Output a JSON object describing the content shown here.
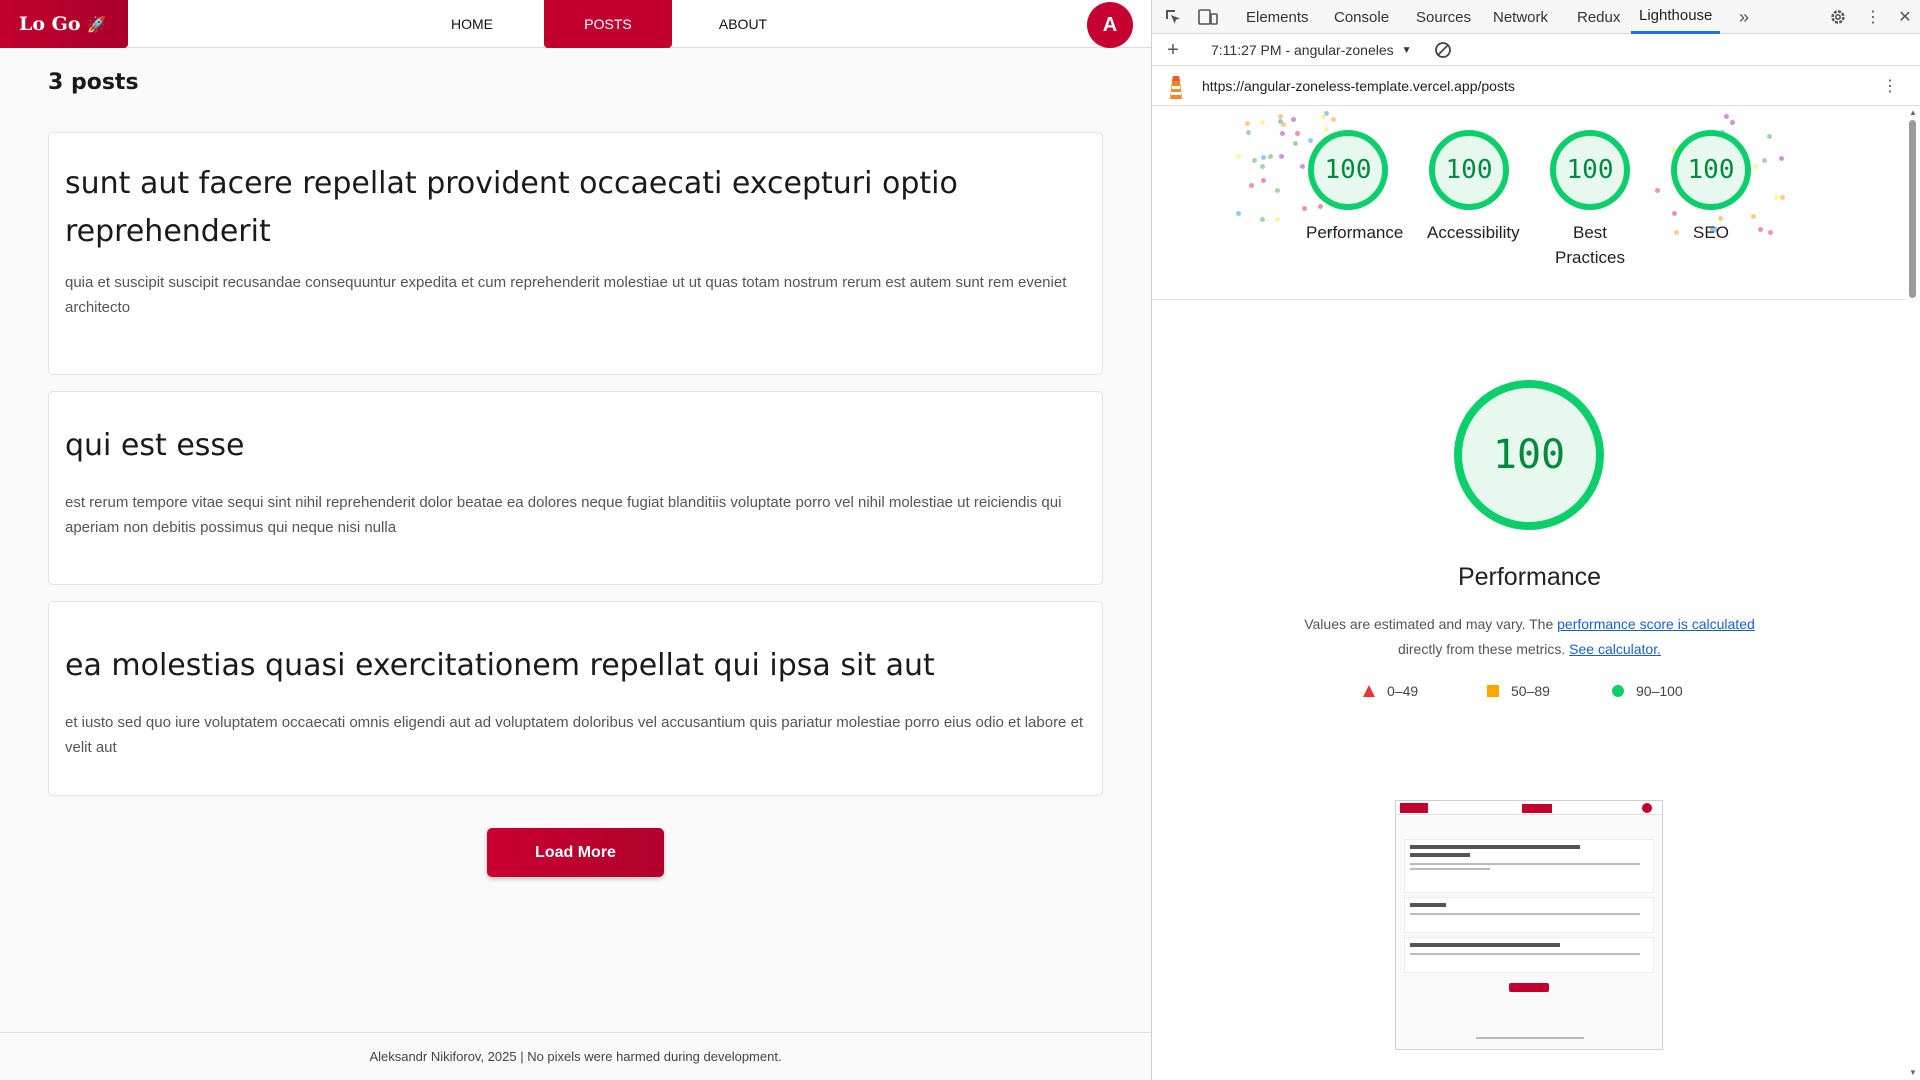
{
  "app": {
    "logo": "Lo Go",
    "nav": {
      "home": "HOME",
      "posts": "POSTS",
      "about": "ABOUT"
    },
    "avatar": "A",
    "post_count": "3 posts",
    "posts": [
      {
        "title": "sunt aut facere repellat provident occaecati excepturi optio reprehenderit",
        "body": "quia et suscipit suscipit recusandae consequuntur expedita et cum reprehenderit molestiae ut ut quas totam nostrum rerum est autem sunt rem eveniet architecto"
      },
      {
        "title": "qui est esse",
        "body": "est rerum tempore vitae sequi sint nihil reprehenderit dolor beatae ea dolores neque fugiat blanditiis voluptate porro vel nihil molestiae ut reiciendis qui aperiam non debitis possimus qui neque nisi nulla"
      },
      {
        "title": "ea molestias quasi exercitationem repellat qui ipsa sit aut",
        "body": "et iusto sed quo iure voluptatem occaecati omnis eligendi aut ad voluptatem doloribus vel accusantium quis pariatur molestiae porro eius odio et labore et velit aut"
      }
    ],
    "load_more": "Load More",
    "footer": "Aleksandr Nikiforov, 2025 | No pixels were harmed during development."
  },
  "devtools": {
    "tabs": [
      "Elements",
      "Console",
      "Sources",
      "Network",
      "Redux",
      "Lighthouse"
    ],
    "active_tab": "Lighthouse",
    "report_label": "7:11:27 PM - angular-zoneles",
    "url": "https://angular-zoneless-template.vercel.app/posts",
    "scores": [
      {
        "value": "100",
        "label": "Performance"
      },
      {
        "value": "100",
        "label": "Accessibility"
      },
      {
        "value": "100",
        "label": "Best Practices"
      },
      {
        "value": "100",
        "label": "SEO"
      }
    ],
    "main_score": "100",
    "main_title": "Performance",
    "desc_prefix": "Values are estimated and may vary. The ",
    "desc_link1": "performance score is calculated",
    "desc_mid": "directly from these metrics.",
    "desc_link2": "See calculator.",
    "legend": [
      {
        "range": "0–49",
        "color": "#e53935"
      },
      {
        "range": "50–89",
        "color": "#ffa400"
      },
      {
        "range": "90–100",
        "color": "#0cce6b"
      }
    ]
  },
  "colors": {
    "brand": "#c2002f",
    "score_good": "#0cce6b",
    "link": "#1a5fd0"
  }
}
